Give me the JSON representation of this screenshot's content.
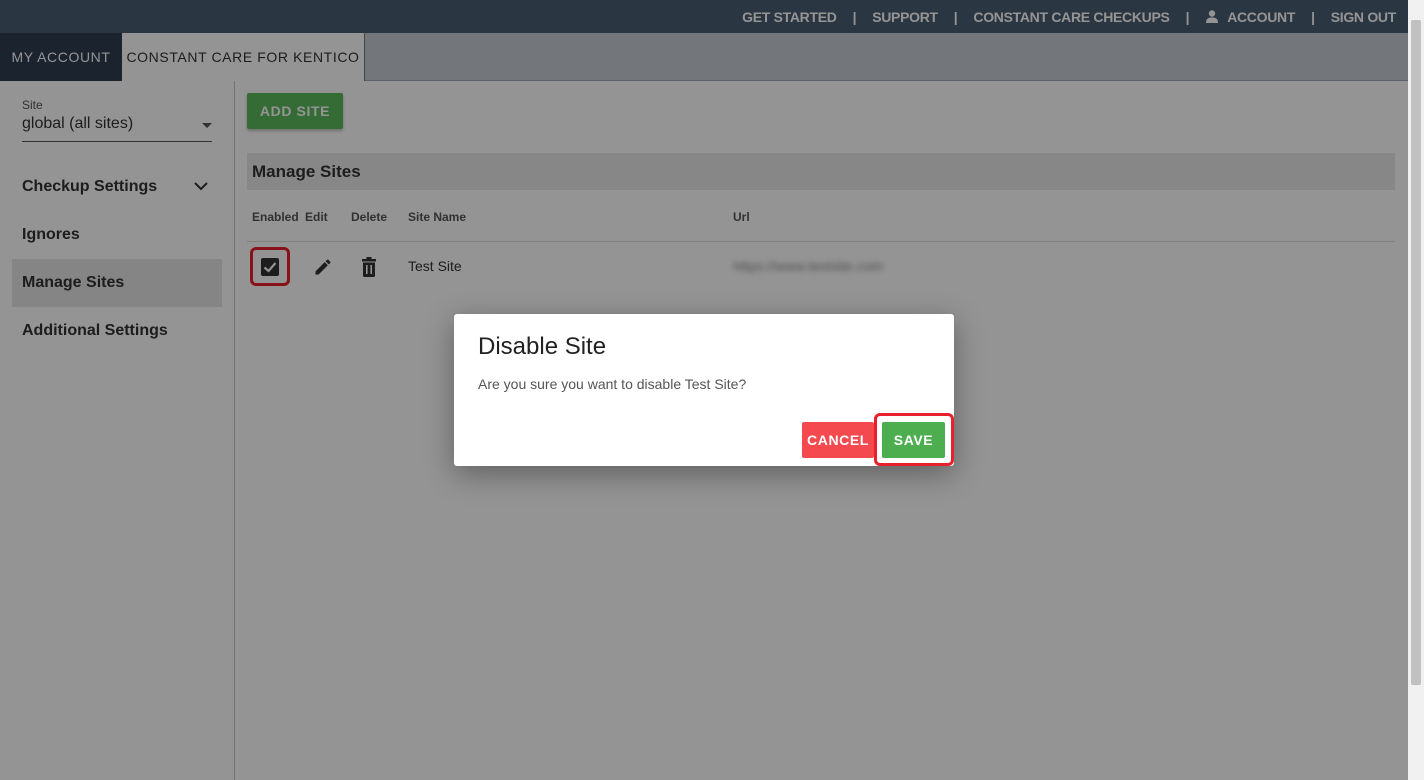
{
  "topnav": {
    "get_started": "GET STARTED",
    "support": "SUPPORT",
    "constant_care_checkups": "CONSTANT CARE CHECKUPS",
    "account": "ACCOUNT",
    "sign_out": "SIGN OUT",
    "separator": "|"
  },
  "tabs": [
    {
      "label": "MY ACCOUNT"
    },
    {
      "label": "CONSTANT CARE FOR KENTICO"
    }
  ],
  "sidebar": {
    "site_label": "Site",
    "site_value": "global (all sites)",
    "items": [
      {
        "label": "Checkup Settings"
      },
      {
        "label": "Ignores"
      },
      {
        "label": "Manage Sites"
      },
      {
        "label": "Additional Settings"
      }
    ]
  },
  "main": {
    "add_site_label": "ADD SITE",
    "section_title": "Manage Sites",
    "columns": [
      "Enabled",
      "Edit",
      "Delete",
      "Site Name",
      "Url"
    ],
    "rows": [
      {
        "site_name": "Test Site",
        "url": "https://www.testsite.com"
      }
    ]
  },
  "dialog": {
    "title": "Disable Site",
    "body": "Are you sure you want to disable Test Site?",
    "cancel_label": "CANCEL",
    "save_label": "SAVE"
  },
  "colors": {
    "topbar": "#4a5d74",
    "dark_tab": "#2d3d50",
    "success": "#5cb85c",
    "danger": "#f44a4f",
    "highlight": "#e8202b"
  },
  "icons": {
    "user": "user-icon",
    "chevron": "chevron-down-icon",
    "checkbox": "checkbox-checked-icon",
    "edit": "pencil-icon",
    "delete": "trash-icon"
  }
}
